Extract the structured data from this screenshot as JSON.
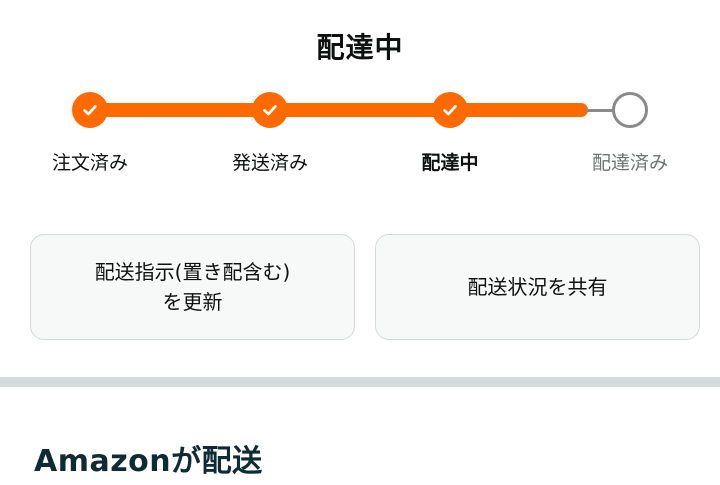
{
  "header": {
    "status_title": "配達中"
  },
  "tracker": {
    "steps": [
      {
        "label": "注文済み",
        "state": "done"
      },
      {
        "label": "発送済み",
        "state": "done"
      },
      {
        "label": "配達中",
        "state": "current"
      },
      {
        "label": "配達済み",
        "state": "pending"
      }
    ],
    "colors": {
      "active": "#ff6a00",
      "inactive": "#8a8a8a"
    },
    "icons": {
      "done": "checkmark-icon",
      "pending": "empty-circle-icon"
    }
  },
  "actions": {
    "delivery_instructions": {
      "line1": "配送指示(置き配含む)",
      "line2": "を更新"
    },
    "share_status": {
      "label": "配送状況を共有"
    }
  },
  "section": {
    "heading": "Amazonが配送"
  }
}
